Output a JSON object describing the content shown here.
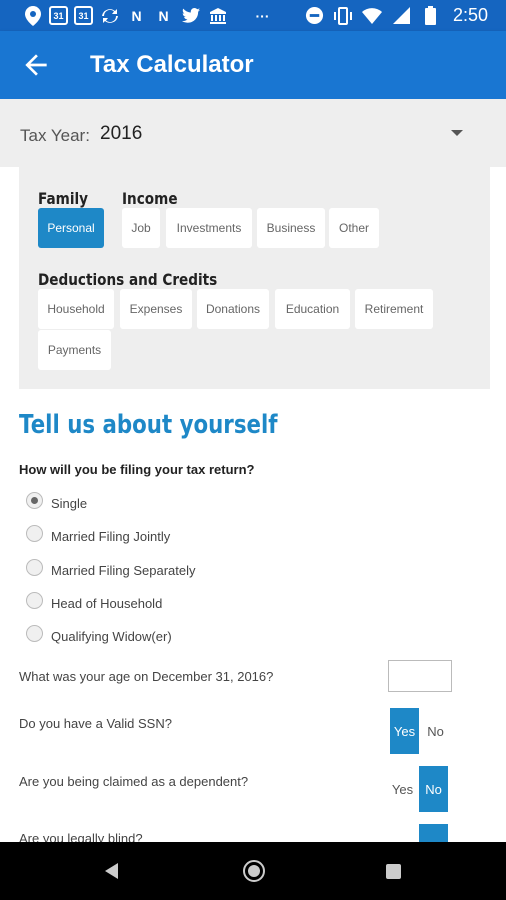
{
  "status_bar": {
    "time": "2:50",
    "left_icons": [
      "location-pin-icon",
      "calendar-31-icon",
      "calendar-31-icon",
      "sync-icon",
      "n-icon",
      "n-icon",
      "twitter-icon",
      "bank-icon",
      "more-dots-icon"
    ],
    "calendar_text": "31",
    "n_text": "N",
    "dots_text": "···",
    "right_icons": [
      "do-not-disturb-icon",
      "vibrate-icon",
      "wifi-icon",
      "signal-icon",
      "battery-icon"
    ]
  },
  "app_bar": {
    "title": "Tax Calculator",
    "back_icon": "arrow-back-icon"
  },
  "tax_year": {
    "label": "Tax Year:",
    "value": "2016"
  },
  "nav": {
    "family_heading": "Family",
    "income_heading": "Income",
    "deductions_heading": "Deductions and Credits",
    "family_items": [
      {
        "label": "Personal",
        "active": true
      }
    ],
    "income_items": [
      {
        "label": "Job"
      },
      {
        "label": "Investments"
      },
      {
        "label": "Business"
      },
      {
        "label": "Other"
      }
    ],
    "deduction_items": [
      {
        "label": "Household"
      },
      {
        "label": "Expenses"
      },
      {
        "label": "Donations"
      },
      {
        "label": "Education"
      },
      {
        "label": "Retirement"
      },
      {
        "label": "Payments"
      }
    ]
  },
  "form": {
    "section_title": "Tell us about yourself",
    "filing_question": "How will you be filing your tax return?",
    "filing_options": [
      {
        "label": "Single",
        "selected": true
      },
      {
        "label": "Married Filing Jointly",
        "selected": false
      },
      {
        "label": "Married Filing Separately",
        "selected": false
      },
      {
        "label": "Head of Household",
        "selected": false
      },
      {
        "label": "Qualifying Widow(er)",
        "selected": false
      }
    ],
    "age_question": "What was your age on December 31, 2016?",
    "age_value": "",
    "ssn_question": "Do you have a Valid SSN?",
    "ssn_answer": "Yes",
    "dependent_question": "Are you being claimed as a dependent?",
    "dependent_answer": "No",
    "blind_question": "Are you legally blind?",
    "yes_label": "Yes",
    "no_label": "No"
  },
  "colors": {
    "app_bar": "#1976D2",
    "status_bar": "#1565C0",
    "accent": "#1E88C7"
  }
}
